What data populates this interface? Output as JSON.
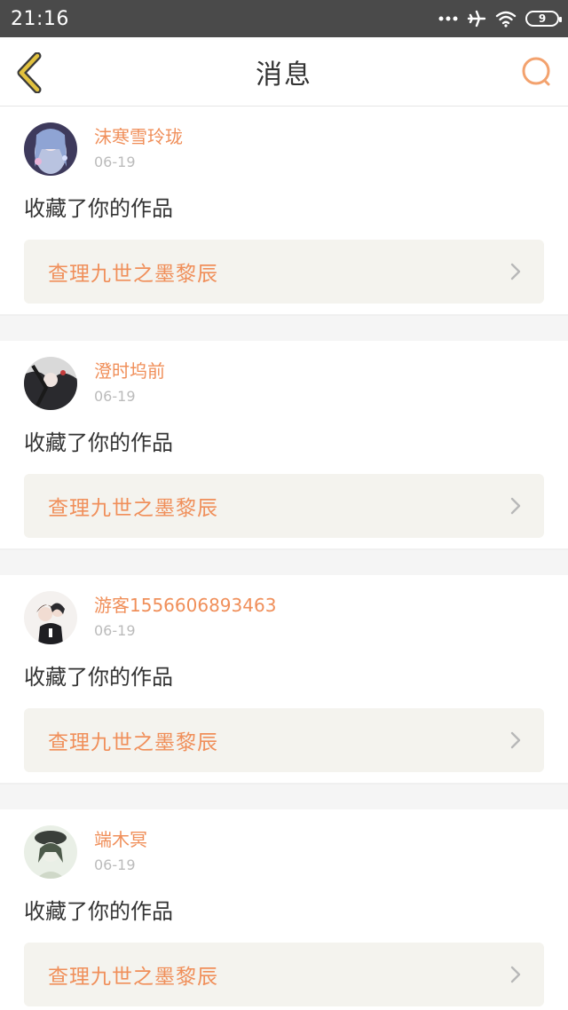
{
  "status_bar": {
    "time": "21:16",
    "battery": "9",
    "icons": [
      "dots-icon",
      "airplane-icon",
      "wifi-icon",
      "battery-icon"
    ]
  },
  "nav": {
    "title": "消息",
    "back_icon": "chevron-left-icon",
    "search_icon": "search-icon",
    "accent_color": "#f08f5a",
    "back_color": "#d4b437"
  },
  "messages": [
    {
      "username": "沫寒雪玲珑",
      "date": "06-19",
      "action": "收藏了你的作品",
      "work_title": "查理九世之墨黎辰"
    },
    {
      "username": "澄时坞前",
      "date": "06-19",
      "action": "收藏了你的作品",
      "work_title": "查理九世之墨黎辰"
    },
    {
      "username": "游客1556606893463",
      "date": "06-19",
      "action": "收藏了你的作品",
      "work_title": "查理九世之墨黎辰"
    },
    {
      "username": "端木冥",
      "date": "06-19",
      "action": "收藏了你的作品",
      "work_title": "查理九世之墨黎辰"
    }
  ]
}
